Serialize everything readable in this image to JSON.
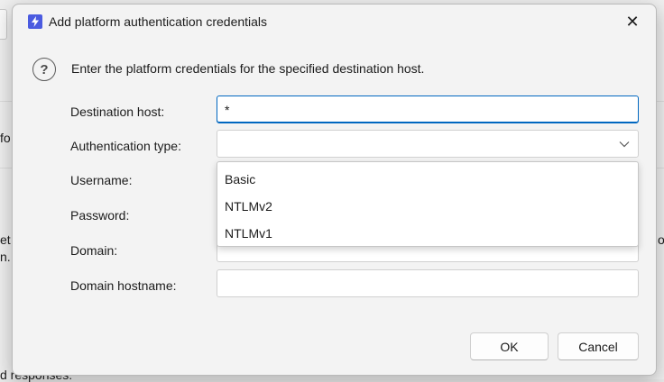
{
  "background": {
    "fragment_left_1": "fo",
    "fragment_left_2": "et",
    "fragment_left_3": "n.",
    "fragment_right": "o",
    "fragment_bottom": "d responses:"
  },
  "dialog": {
    "title": "Add platform authentication credentials",
    "close_glyph": "✕",
    "instruction": "Enter the platform credentials for the specified destination host.",
    "fields": {
      "destination_host": {
        "label": "Destination host:",
        "value": "*"
      },
      "authentication_type": {
        "label": "Authentication type:",
        "value": ""
      },
      "username": {
        "label": "Username:",
        "value": ""
      },
      "password": {
        "label": "Password:",
        "value": ""
      },
      "domain": {
        "label": "Domain:",
        "value": ""
      },
      "domain_hostname": {
        "label": "Domain hostname:",
        "value": ""
      }
    },
    "auth_options": [
      "Basic",
      "NTLMv2",
      "NTLMv1"
    ],
    "buttons": {
      "ok": "OK",
      "cancel": "Cancel"
    }
  },
  "icons": {
    "app": "lightning-bolt-icon",
    "question": "question-mark-icon",
    "close": "close-icon",
    "dropdown": "chevron-down-icon"
  },
  "colors": {
    "accent": "#0067c0",
    "app_icon": "#4b5be0",
    "dialog_bg": "#f3f3f3"
  }
}
